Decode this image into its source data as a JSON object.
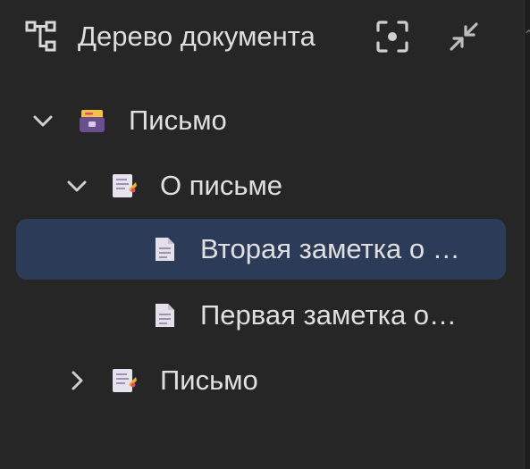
{
  "header": {
    "icon": "tree-structure-icon",
    "title": "Дерево документа",
    "focus_icon": "focus-target-icon",
    "collapse_icon": "collapse-arrows-icon"
  },
  "tree": {
    "items": [
      {
        "label": "Письмо",
        "icon": "archive-box-icon",
        "expanded": true
      },
      {
        "label": "О письме",
        "icon": "note-document-icon",
        "expanded": true
      },
      {
        "label": "Вторая заметка о …",
        "icon": "page-icon",
        "selected": true
      },
      {
        "label": "Первая заметка о…",
        "icon": "page-icon"
      },
      {
        "label": "Письмо",
        "icon": "note-document-icon",
        "expanded": false
      }
    ]
  },
  "colors": {
    "background": "#262626",
    "selection": "#2c3b58",
    "text": "#e0e0e0"
  }
}
